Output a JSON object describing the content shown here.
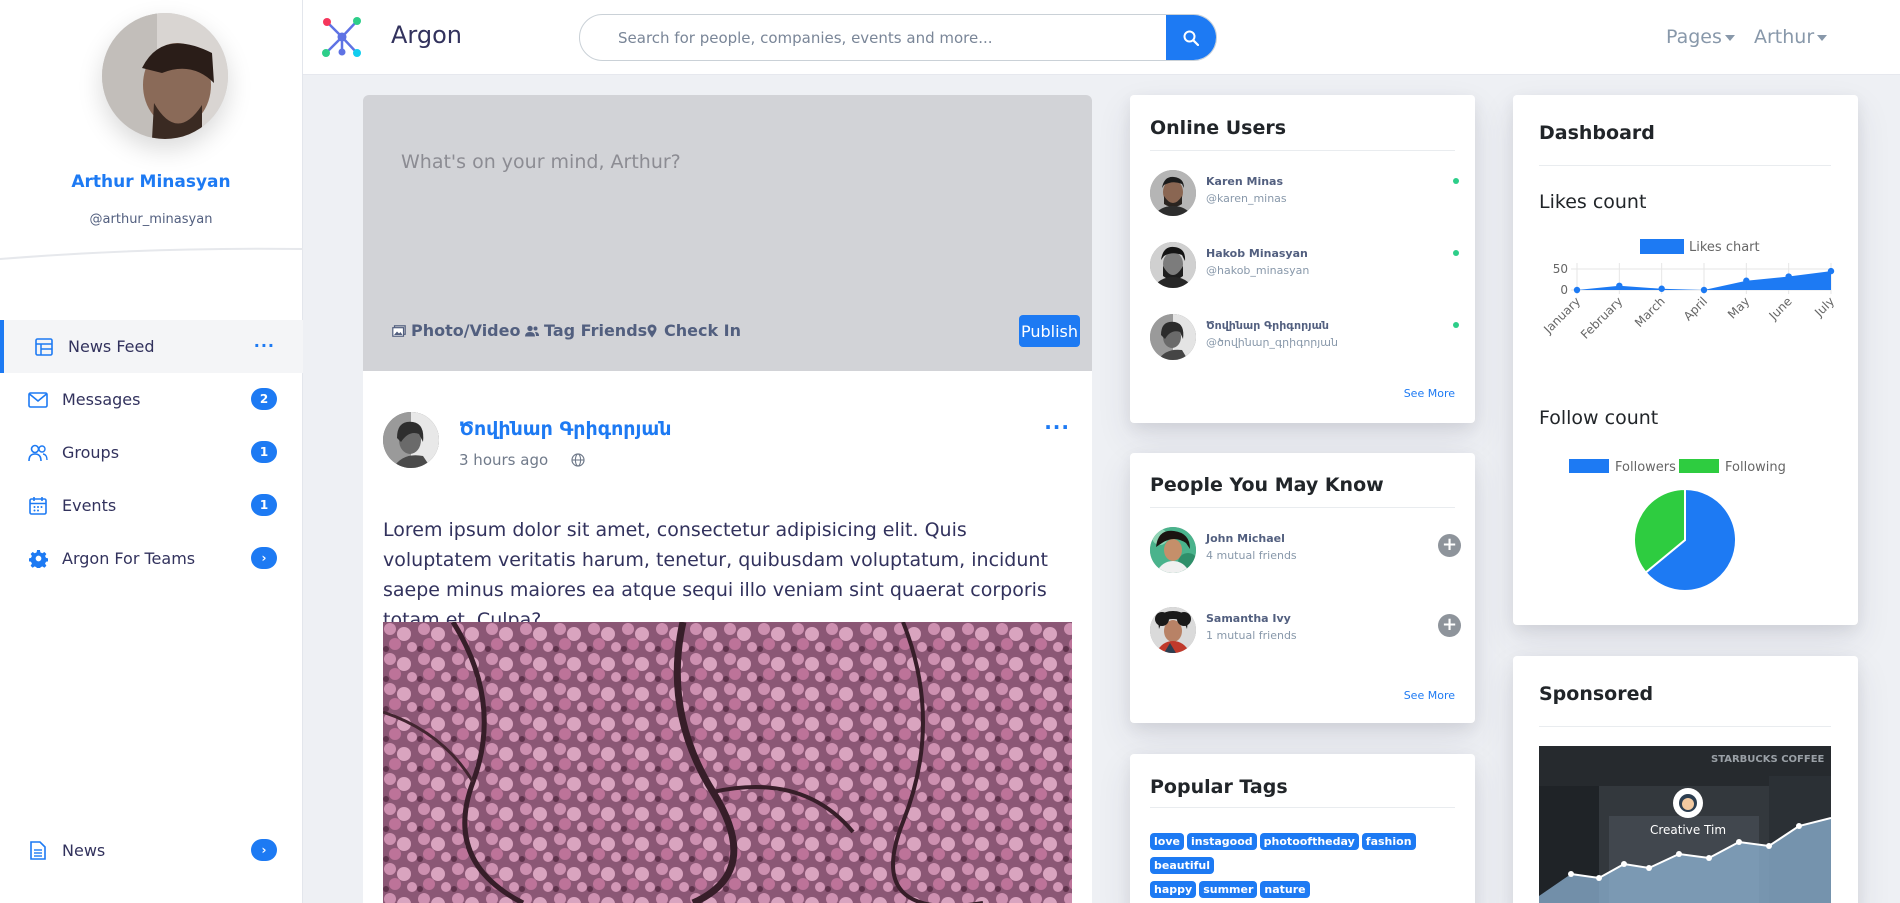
{
  "profile": {
    "name": "Arthur Minasyan",
    "username": "@arthur_minasyan"
  },
  "nav": {
    "items": [
      {
        "label": "News Feed",
        "icon": "table-icon",
        "active": true
      },
      {
        "label": "Messages",
        "icon": "envelope-icon",
        "badge": "2"
      },
      {
        "label": "Groups",
        "icon": "users-icon",
        "badge": "1"
      },
      {
        "label": "Events",
        "icon": "calendar-icon",
        "badge": "1"
      },
      {
        "label": "Argon For Teams",
        "icon": "gear-icon",
        "badge": "›"
      }
    ],
    "bottom": {
      "label": "News",
      "icon": "document-icon",
      "badge": "›"
    },
    "more_label": "···"
  },
  "topbar": {
    "brand": "Argon",
    "search_placeholder": "Search for people, companies, events and more...",
    "pages_label": "Pages",
    "user_label": "Arthur"
  },
  "composer": {
    "placeholder": "What's on your mind, Arthur?",
    "photo_label": "Photo/Video",
    "tag_label": "Tag Friends",
    "checkin_label": "Check In",
    "publish_label": "Publish"
  },
  "post": {
    "author": "Ծովինար Գրիգորյան",
    "time": "3 hours ago",
    "more": "···",
    "body": "Lorem ipsum dolor sit amet, consectetur adipisicing elit. Quis voluptatem veritatis harum, tenetur, quibusdam voluptatum, incidunt saepe minus maiores ea atque sequi illo veniam sint quaerat corporis totam et. Culpa?"
  },
  "online_users": {
    "title": "Online Users",
    "users": [
      {
        "name": "Karen Minas",
        "handle": "@karen_minas"
      },
      {
        "name": "Hakob Minasyan",
        "handle": "@hakob_minasyan"
      },
      {
        "name": "Ծովինար Գրիգորյան",
        "handle": "@ծովինար_գրիգորյան"
      }
    ],
    "see_more": "See More"
  },
  "people": {
    "title": "People You May Know",
    "users": [
      {
        "name": "John Michael",
        "mutual": "4 mutual friends"
      },
      {
        "name": "Samantha Ivy",
        "mutual": "1 mutual friends"
      }
    ],
    "see_more": "See More"
  },
  "tags": {
    "title": "Popular Tags",
    "items": [
      "love",
      "instagood",
      "photooftheday",
      "fashion",
      "beautiful",
      "happy",
      "summer",
      "nature"
    ]
  },
  "dashboard": {
    "title": "Dashboard",
    "likes_title": "Likes count",
    "follow_title": "Follow count"
  },
  "sponsored": {
    "title": "Sponsored",
    "caption": "Creative Tim",
    "sign": "STARBUCKS COFFEE"
  },
  "colors": {
    "primary": "#1d7af3",
    "green": "#2dce89",
    "following": "#2ecc40"
  },
  "chart_data": [
    {
      "type": "area",
      "title": "",
      "legend": [
        "Likes chart"
      ],
      "categories": [
        "January",
        "February",
        "March",
        "April",
        "May",
        "June",
        "July"
      ],
      "series": [
        {
          "name": "Likes chart",
          "values": [
            0,
            10,
            3,
            0,
            22,
            32,
            45
          ]
        }
      ],
      "yticks": [
        0,
        50
      ],
      "ylim": [
        0,
        50
      ]
    },
    {
      "type": "pie",
      "title": "",
      "legend": [
        "Followers",
        "Following"
      ],
      "series": [
        {
          "name": "Followers",
          "value": 64
        },
        {
          "name": "Following",
          "value": 36
        }
      ]
    }
  ]
}
